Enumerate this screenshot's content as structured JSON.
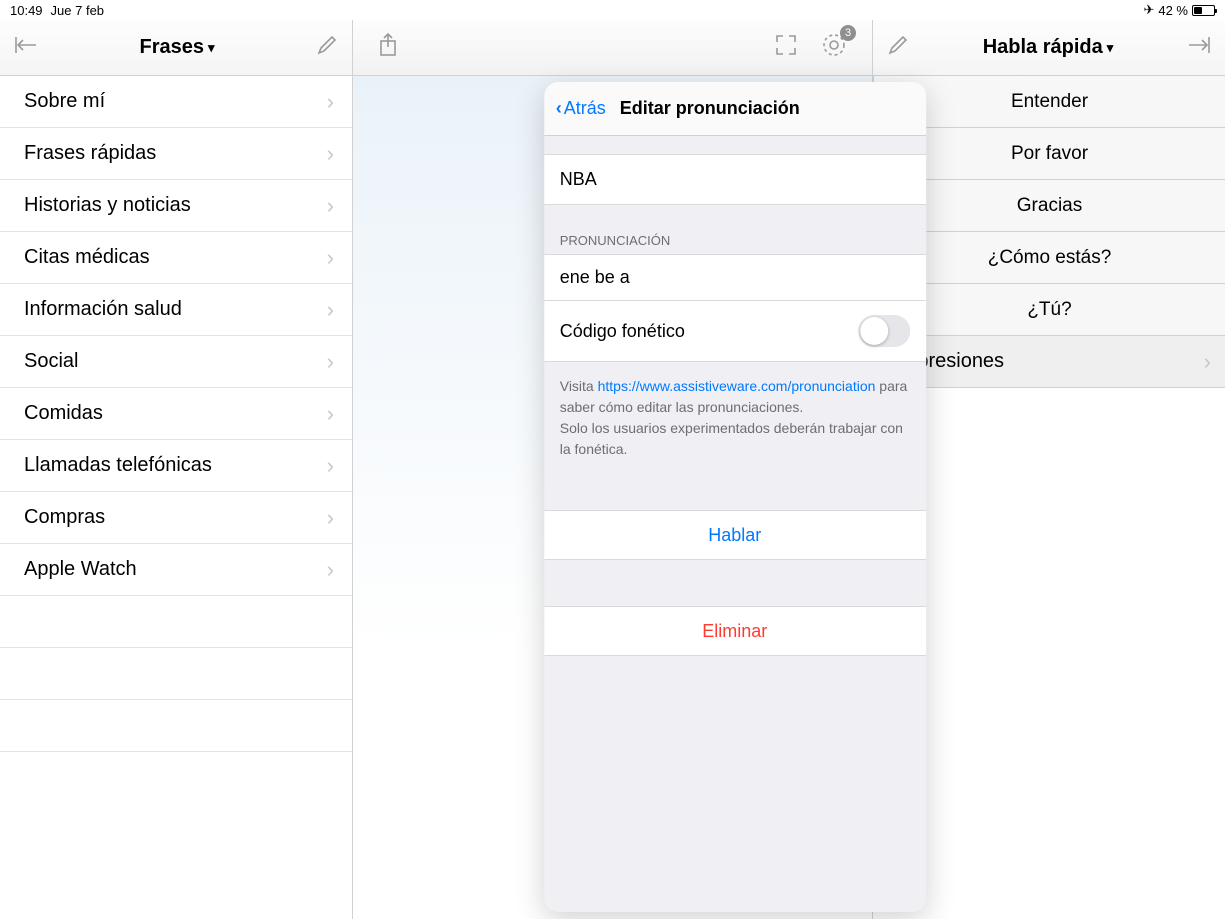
{
  "status": {
    "time": "10:49",
    "date": "Jue 7 feb",
    "battery_pct": "42 %"
  },
  "left": {
    "title": "Frases",
    "items": [
      "Sobre mí",
      "Frases rápidas",
      "Historias y noticias",
      "Citas médicas",
      "Información salud",
      "Social",
      "Comidas",
      "Llamadas telefónicas",
      "Compras",
      "Apple Watch"
    ]
  },
  "mid": {
    "gear_badge": "3"
  },
  "right": {
    "title": "Habla rápida",
    "items": [
      "Entender",
      "Por favor",
      "Gracias",
      "¿Cómo estás?",
      "¿Tú?"
    ],
    "expresiones": "Expresiones"
  },
  "popover": {
    "back": "Atrás",
    "title": "Editar pronunciación",
    "word": "NBA",
    "section_pron": "PRONUNCIACIÓN",
    "pron_value": "ene be a",
    "phonetic_label": "Código fonético",
    "note_prefix": "Visita ",
    "note_link": "https://www.assistiveware.com/pronunciation",
    "note_mid": " para saber cómo editar las pronunciaciones.",
    "note_line2": "Solo los usuarios experimentados deberán trabajar con la fonética.",
    "speak": "Hablar",
    "delete": "Eliminar"
  }
}
